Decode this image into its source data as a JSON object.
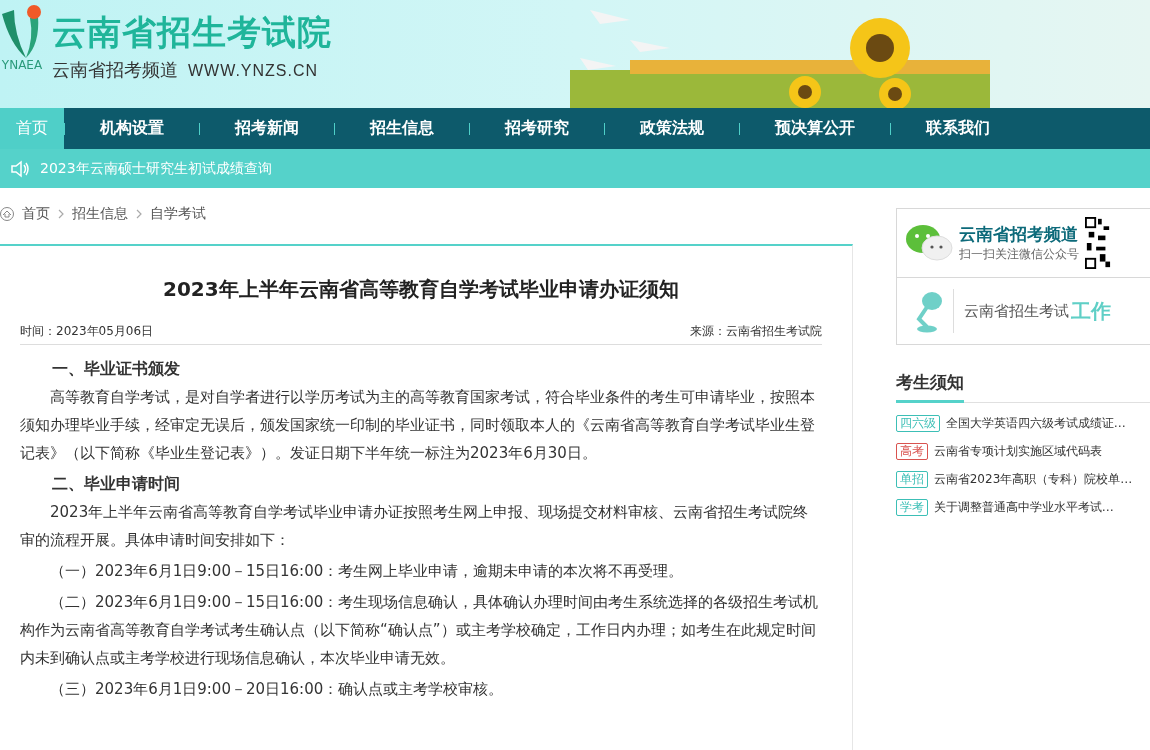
{
  "header": {
    "site_name": "云南省招生考试院",
    "subtitle": "云南省招考频道",
    "url": "WWW.YNZS.CN",
    "logo_text": "YNAEA"
  },
  "nav": [
    {
      "label": "首页",
      "selected": true
    },
    {
      "label": "机构设置",
      "selected": false
    },
    {
      "label": "招考新闻",
      "selected": false
    },
    {
      "label": "招生信息",
      "selected": false
    },
    {
      "label": "招考研究",
      "selected": false
    },
    {
      "label": "政策法规",
      "selected": false
    },
    {
      "label": "预决算公开",
      "selected": false
    },
    {
      "label": "联系我们",
      "selected": false
    }
  ],
  "ticker": "2023年云南硕士研究生初试成绩查询",
  "breadcrumb": [
    "首页",
    "招生信息",
    "自学考试"
  ],
  "article": {
    "title": "2023年上半年云南省高等教育自学考试毕业申请办证须知",
    "time": "时间：2023年05月06日",
    "source": "来源：云南省招生考试院",
    "blocks": [
      {
        "kind": "heading",
        "text": "一、毕业证书颁发"
      },
      {
        "kind": "para",
        "text": "高等教育自学考试，是对自学者进行以学历考试为主的高等教育国家考试，符合毕业条件的考生可申请毕业，按照本须知办理毕业手续，经审定无误后，颁发国家统一印制的毕业证书，同时领取本人的《云南省高等教育自学考试毕业生登记表》（以下简称《毕业生登记表》）。发证日期下半年统一标注为2023年6月30日。"
      },
      {
        "kind": "heading",
        "text": "二、毕业申请时间"
      },
      {
        "kind": "para",
        "text": "2023年上半年云南省高等教育自学考试毕业申请办证按照考生网上申报、现场提交材料审核、云南省招生考试院终审的流程开展。具体申请时间安排如下："
      },
      {
        "kind": "para",
        "text": "（一）2023年6月1日9:00－15日16:00：考生网上毕业申请，逾期未申请的本次将不再受理。"
      },
      {
        "kind": "para",
        "text": "（二）2023年6月1日9:00－15日16:00：考生现场信息确认，具体确认办理时间由考生系统选择的各级招生考试机构作为云南省高等教育自学考试考生确认点（以下简称“确认点”）或主考学校确定，工作日内办理；如考生在此规定时间内未到确认点或主考学校进行现场信息确认，本次毕业申请无效。"
      },
      {
        "kind": "para",
        "text": "（三）2023年6月1日9:00－20日16:00：确认点或主考学校审核。"
      }
    ]
  },
  "sidebar": {
    "wechat_title": "云南省招考频道",
    "wechat_sub": "扫一扫关注微信公众号",
    "work_text": "云南省招生考试",
    "work_highlight": "工作",
    "notice_title": "考生须知",
    "notices": [
      {
        "tag": "四六级",
        "color": "#3cbfb6",
        "text": "全国大学英语四六级考试成绩证…"
      },
      {
        "tag": "高考",
        "color": "#d9534f",
        "text": "云南省专项计划实施区域代码表"
      },
      {
        "tag": "单招",
        "color": "#3cbfb6",
        "text": "云南省2023年高职（专科）院校单…"
      },
      {
        "tag": "学考",
        "color": "#3cbfb6",
        "text": "关于调整普通高中学业水平考试…"
      }
    ]
  }
}
